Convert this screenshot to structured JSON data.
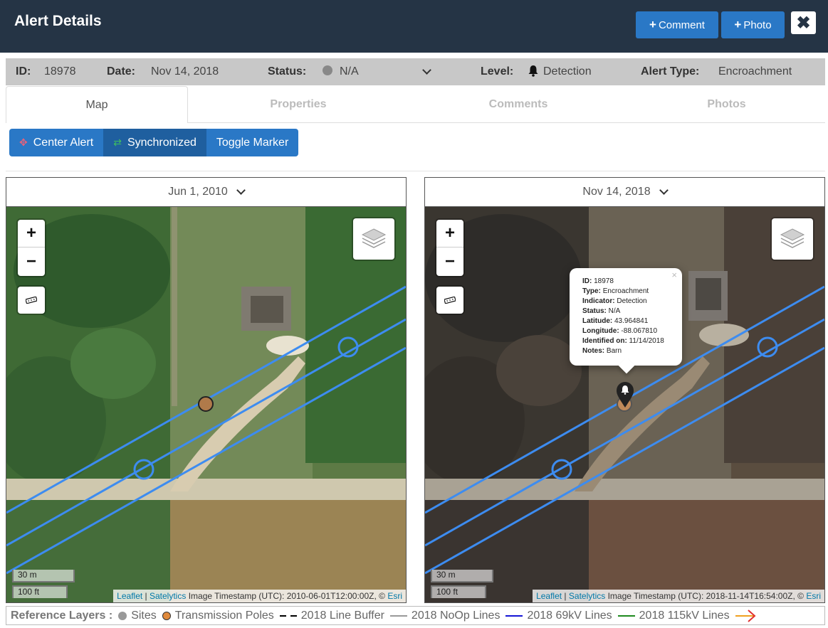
{
  "header": {
    "title": "Alert Details",
    "comment_label": "Comment",
    "photo_label": "Photo",
    "close_glyph": "✖"
  },
  "info": {
    "id_label": "ID:",
    "id_value": "18978",
    "date_label": "Date:",
    "date_value": "Nov 14, 2018",
    "status_label": "Status:",
    "status_value": "N/A",
    "level_label": "Level:",
    "level_value": "Detection",
    "type_label": "Alert Type:",
    "type_value": "Encroachment"
  },
  "tabs": [
    "Map",
    "Properties",
    "Comments",
    "Photos"
  ],
  "toolbar": {
    "center_alert": "Center Alert",
    "synchronized": "Synchronized",
    "toggle_marker": "Toggle Marker"
  },
  "maps": {
    "left": {
      "date": "Jun 1, 2010",
      "scale_m": "30 m",
      "scale_ft": "100 ft",
      "attrib_leaflet": "Leaflet",
      "attrib_satelytics": "Satelytics",
      "attrib_text": " Image Timestamp (UTC): 2010-06-01T12:00:00Z, © ",
      "attrib_esri": "Esri"
    },
    "right": {
      "date": "Nov 14, 2018",
      "scale_m": "30 m",
      "scale_ft": "100 ft",
      "attrib_leaflet": "Leaflet",
      "attrib_satelytics": "Satelytics",
      "attrib_text": " Image Timestamp (UTC): 2018-11-14T16:54:00Z, © ",
      "attrib_esri": "Esri"
    },
    "zoom_in": "+",
    "zoom_out": "−"
  },
  "popup": {
    "id_label": "ID:",
    "id_value": " 18978",
    "type_label": "Type:",
    "type_value": " Encroachment",
    "indicator_label": "Indicator:",
    "indicator_value": " Detection",
    "status_label": "Status:",
    "status_value": " N/A",
    "lat_label": "Latitude:",
    "lat_value": " 43.964841",
    "lon_label": "Longitude:",
    "lon_value": " -88.067810",
    "ident_label": "Identified on:",
    "ident_value": " 11/14/2018",
    "notes_label": "Notes:",
    "notes_value": " Barn",
    "close": "×"
  },
  "legend": {
    "title": "Reference Layers :",
    "items": [
      {
        "label": "Sites",
        "color": "#999999",
        "kind": "dot"
      },
      {
        "label": "Transmission Poles",
        "color": "#e08a3c",
        "kind": "dot"
      },
      {
        "label": "2018 Line Buffer",
        "color": "#000000",
        "kind": "dash"
      },
      {
        "label": "2018 NoOp Lines",
        "color": "#999999",
        "kind": "line"
      },
      {
        "label": "2018 69kV Lines",
        "color": "#1515d6",
        "kind": "line"
      },
      {
        "label": "2018 115kV Lines",
        "color": "#1e8a1e",
        "kind": "line"
      }
    ]
  },
  "colors": {
    "header_bg": "#253445",
    "accent": "#2a78c6",
    "line_blue": "#3d8cf0"
  }
}
